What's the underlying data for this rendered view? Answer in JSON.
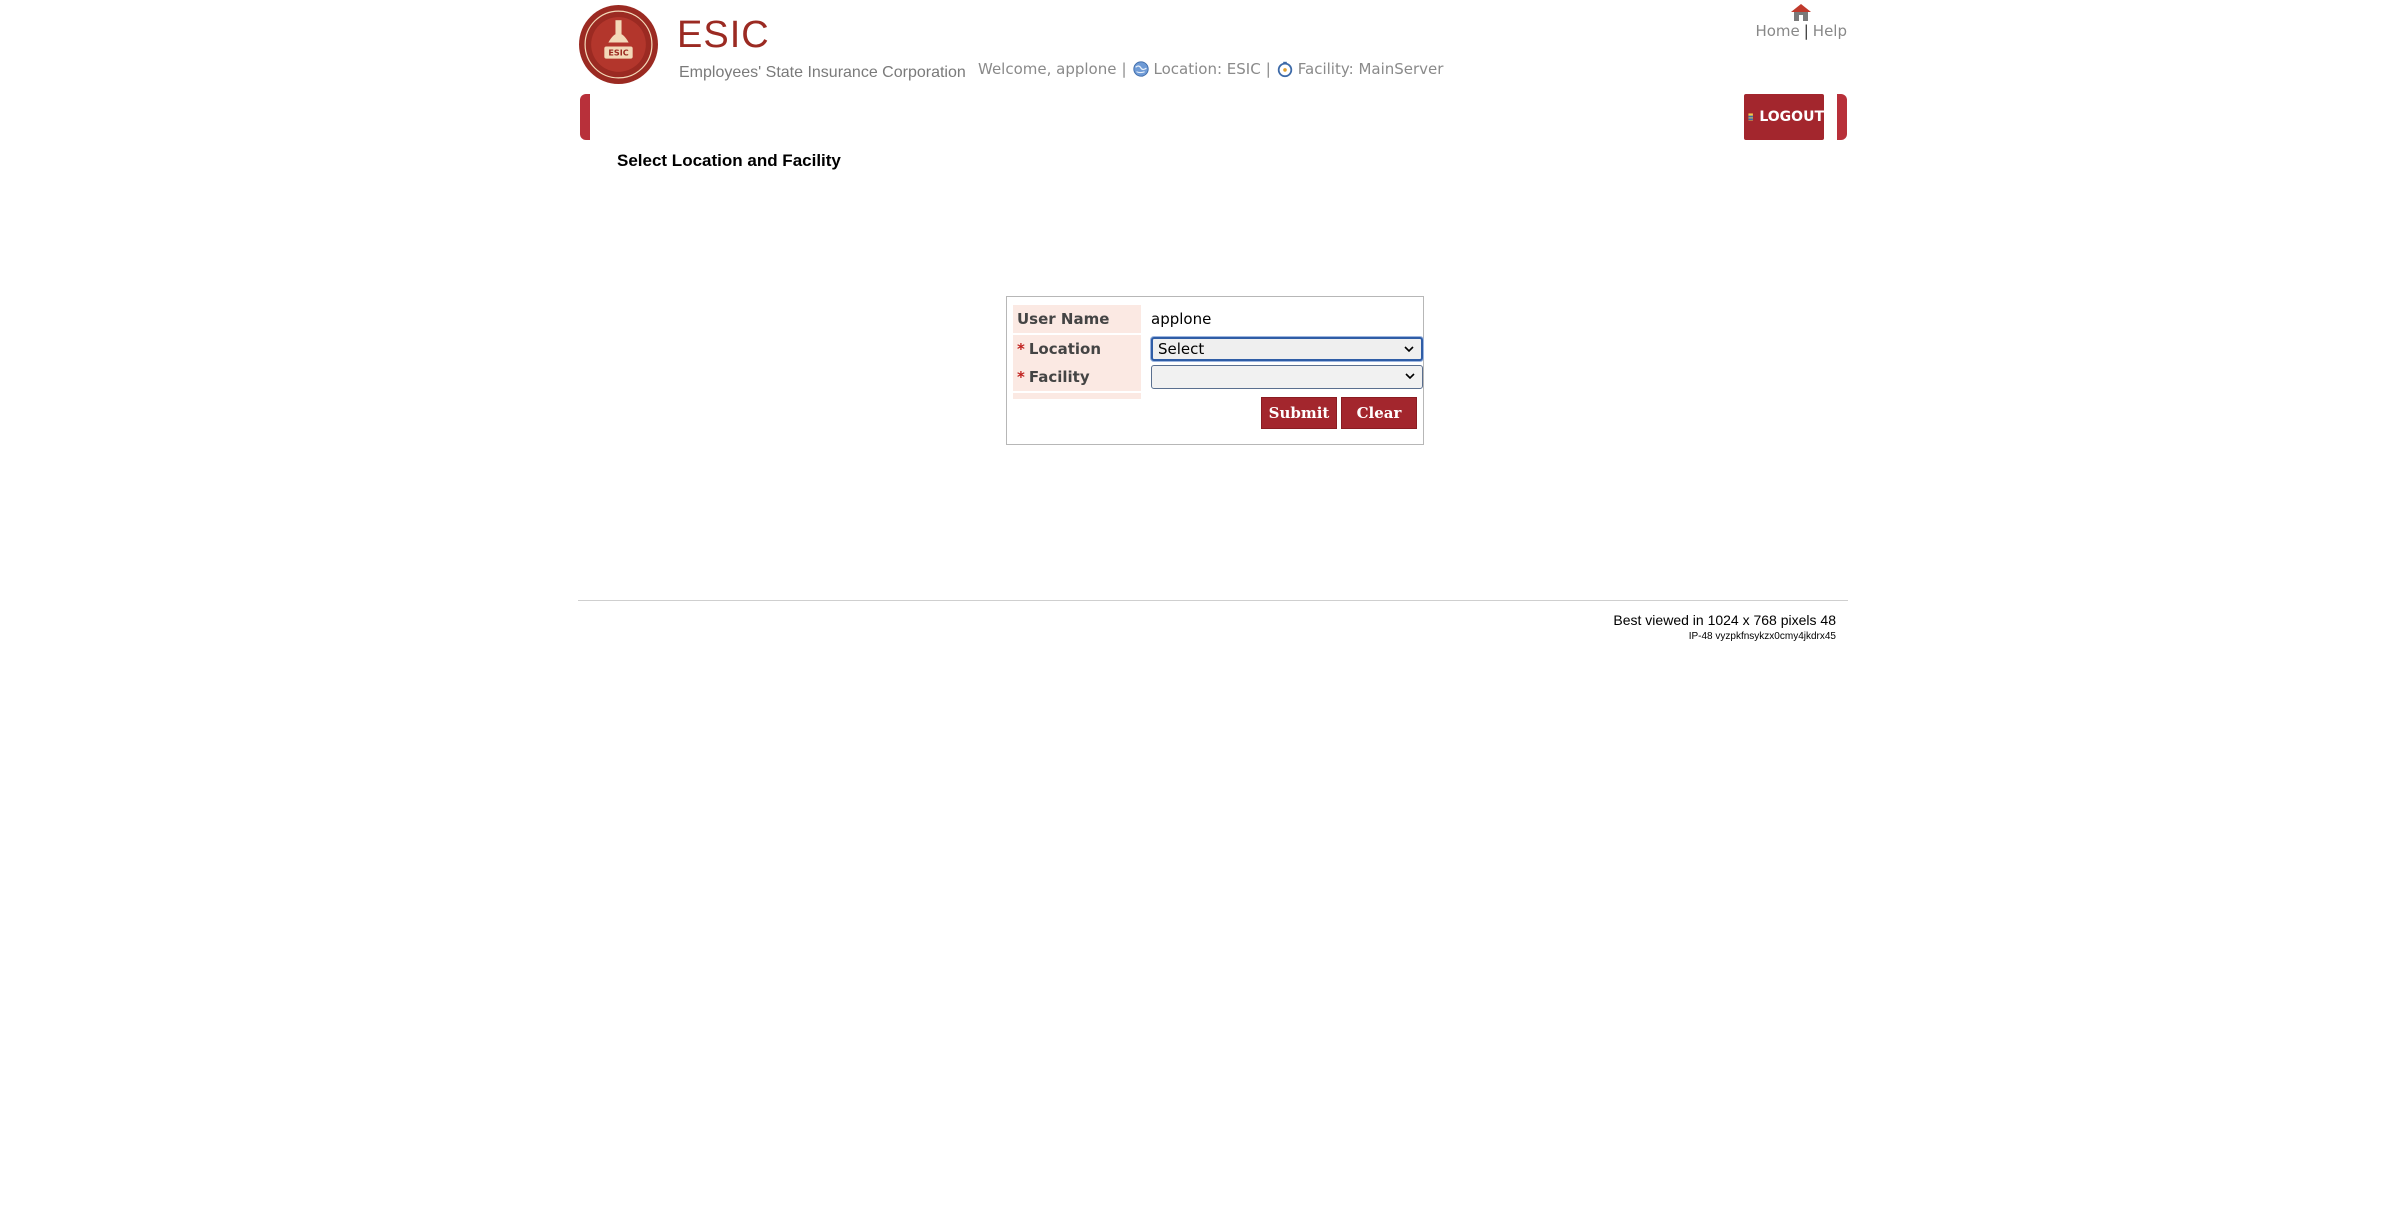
{
  "header": {
    "brand_name": "ESIC",
    "brand_subtitle": "Employees' State Insurance Corporation",
    "brand_color": "#9b2a22",
    "welcome_text": "Welcome, applone",
    "separator": "|",
    "location_text": "Location: ESIC",
    "facility_text": "Facility: MainServer",
    "home_link": "Home",
    "help_link": "Help"
  },
  "nav": {
    "logout_label": "LOGOUT",
    "bar_color": "#a3262d"
  },
  "page": {
    "title": "Select Location and Facility"
  },
  "form": {
    "username_label": "User Name",
    "username_value": "applone",
    "required_mark": "*",
    "location_label": "Location",
    "location_value": "Select",
    "facility_label": "Facility",
    "facility_value": "",
    "submit_label": "Submit",
    "clear_label": "Clear"
  },
  "footer": {
    "best_viewed": "Best viewed in 1024 x 768 pixels 48",
    "server_info": "IP-48 vyzpkfnsykzx0cmy4jkdrx45"
  },
  "icons": [
    "esic-logo",
    "home-icon",
    "globe-icon",
    "facility-icon",
    "logout-icon",
    "chevron-down-icon"
  ]
}
